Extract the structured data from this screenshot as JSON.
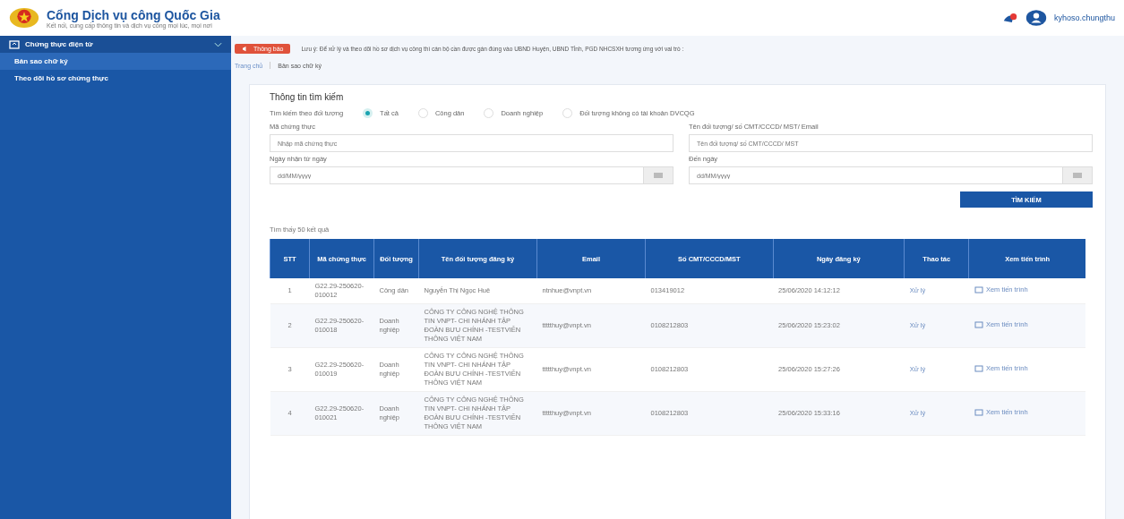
{
  "header": {
    "title": "Cổng Dịch vụ công Quốc Gia",
    "subtitle": "Kết nối, cung cấp thông tin và dịch vụ công mọi lúc, mọi nơi",
    "username": "kyhoso.chungthu"
  },
  "sidebar": {
    "items": [
      {
        "label": "Chứng thực điện tử",
        "expanded": true,
        "children": [
          {
            "label": "Bản sao chữ ký",
            "selected": true
          },
          {
            "label": "Theo dõi hồ sơ chứng thực",
            "selected": false
          }
        ]
      }
    ]
  },
  "notice": {
    "badge": "Thông báo",
    "text": "Lưu ý: Để xử lý và theo dõi hồ sơ dịch vụ công thì cán bộ cần được gán đúng vào UBND Huyện, UBND Tỉnh, PGD NHCSXH tương ứng với vai trò :"
  },
  "breadcrumb": [
    "Trang chủ",
    "Bản sao chữ ký"
  ],
  "search": {
    "title": "Thông tin tìm kiếm",
    "filter_label": "Tìm kiếm theo đối tượng",
    "options": [
      {
        "label": "Tất cả",
        "selected": true
      },
      {
        "label": "Công dân",
        "selected": false
      },
      {
        "label": "Doanh nghiệp",
        "selected": false
      },
      {
        "label": "Đối tượng không có tài khoản DVCQG",
        "selected": false
      }
    ],
    "fields": [
      {
        "label": "Mã chứng thực",
        "placeholder": "Nhập mã chứng thực",
        "kind": "text"
      },
      {
        "label": "Tên đối tượng/ số CMT/CCCD/ MST/ Email",
        "placeholder": "Tên đối tượng/ số CMT/CCCD/ MST",
        "kind": "text"
      },
      {
        "label": "Ngày nhận từ ngày",
        "placeholder": "dd/MM/yyyy",
        "kind": "date"
      },
      {
        "label": "Đến ngày",
        "placeholder": "dd/MM/yyyy",
        "kind": "date"
      }
    ],
    "button": "TÌM KIẾM"
  },
  "results_count": "Tìm thấy 50 kết quả",
  "table": {
    "columns": [
      "STT",
      "Mã chứng thực",
      "Đối tượng",
      "Tên đối tượng đăng ký",
      "Email",
      "Số CMT/CCCD/MST",
      "Ngày đăng ký",
      "Thao tác",
      "Xem tiến trình"
    ],
    "rows": [
      {
        "stt": "1",
        "code": "G22.29-250620-010012",
        "type": "Công dân",
        "name": "Nguyễn Thị Ngọc Huê",
        "email": "ntnhue@vnpt.vn",
        "id": "013419012",
        "date": "25/06/2020 14:12:12",
        "action": "Xử lý",
        "view": "Xem tiến trình"
      },
      {
        "stt": "2",
        "code": "G22.29-250620-010018",
        "type": "Doanh nghiệp",
        "name": "CÔNG TY CÔNG NGHỆ THÔNG TIN VNPT- CHI NHÁNH TẬP ĐOÀN BƯU CHÍNH -TESTVIỄN THÔNG VIỆT NAM",
        "email": "ttttthuy@vnpt.vn",
        "id": "0108212803",
        "date": "25/06/2020 15:23:02",
        "action": "Xử lý",
        "view": "Xem tiến trình"
      },
      {
        "stt": "3",
        "code": "G22.29-250620-010019",
        "type": "Doanh nghiệp",
        "name": "CÔNG TY CÔNG NGHỆ THÔNG TIN VNPT- CHI NHÁNH TẬP ĐOÀN BƯU CHÍNH -TESTVIỄN THÔNG VIỆT NAM",
        "email": "ttttthuy@vnpt.vn",
        "id": "0108212803",
        "date": "25/06/2020 15:27:26",
        "action": "Xử lý",
        "view": "Xem tiến trình"
      },
      {
        "stt": "4",
        "code": "G22.29-250620-010021",
        "type": "Doanh nghiệp",
        "name": "CÔNG TY CÔNG NGHỆ THÔNG TIN VNPT- CHI NHÁNH TẬP ĐOÀN BƯU CHÍNH -TESTVIỄN THÔNG VIỆT NAM",
        "email": "ttttthuy@vnpt.vn",
        "id": "0108212803",
        "date": "25/06/2020 15:33:16",
        "action": "Xử lý",
        "view": "Xem tiến trình"
      }
    ]
  }
}
